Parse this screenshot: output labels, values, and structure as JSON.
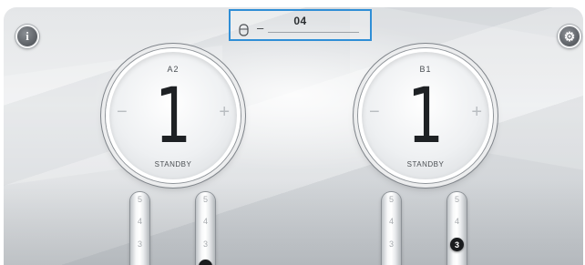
{
  "header": {
    "channel": "04",
    "separator": "–"
  },
  "dials": [
    {
      "label": "A2",
      "value": "1",
      "status": "STANDBY",
      "minus": "−",
      "plus": "+"
    },
    {
      "label": "B1",
      "value": "1",
      "status": "STANDBY",
      "minus": "−",
      "plus": "+"
    }
  ],
  "sliders": [
    {
      "ticks": [
        "5",
        "4",
        "3"
      ],
      "active": null
    },
    {
      "ticks": [
        "5",
        "4",
        "3"
      ],
      "active": null
    },
    {
      "ticks": [
        "5",
        "4",
        "3"
      ],
      "active": null
    },
    {
      "ticks": [
        "5",
        "4",
        "3"
      ],
      "active": "3"
    }
  ],
  "icons": {
    "info": "info-icon",
    "settings": "gear-icon",
    "device": "device-icon"
  },
  "colors": {
    "accent": "#2f8ed6",
    "knob": "#1a1c1e",
    "dial_text": "#1e2124"
  }
}
